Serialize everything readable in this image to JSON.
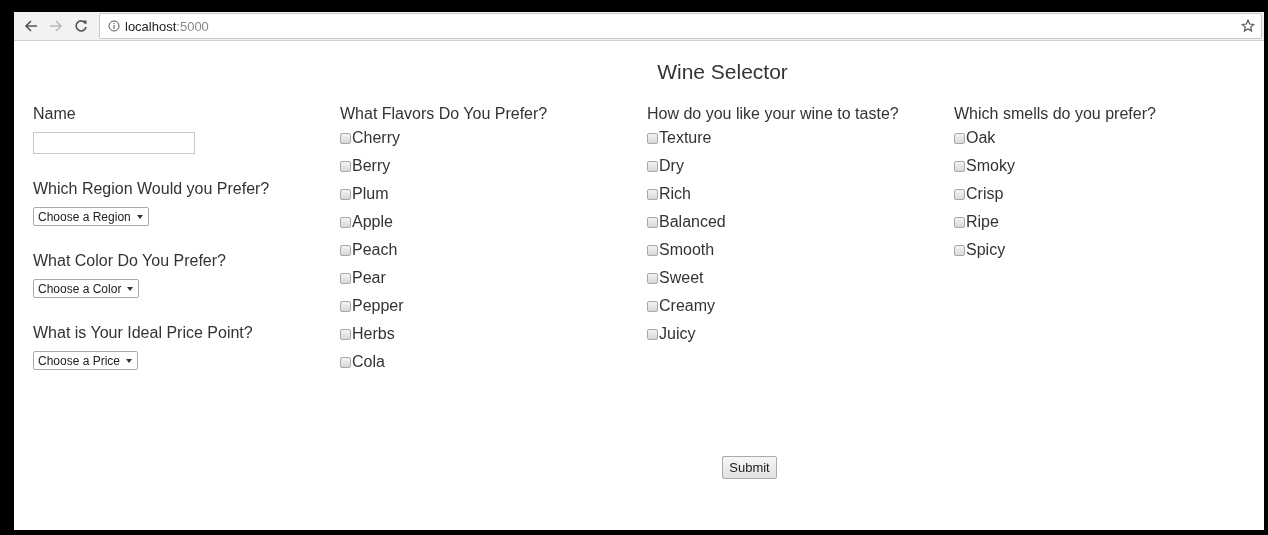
{
  "browser": {
    "host": "localhost",
    "port": ":5000"
  },
  "page": {
    "title": "Wine Selector",
    "columns": [
      {
        "fields": [
          {
            "kind": "text",
            "label": "Name"
          },
          {
            "kind": "select",
            "label": "Which Region Would you Prefer?",
            "value": "Choose a Region"
          },
          {
            "kind": "select",
            "label": "What Color Do You Prefer?",
            "value": "Choose a Color"
          },
          {
            "kind": "select",
            "label": "What is Your Ideal Price Point?",
            "value": "Choose a Price"
          }
        ]
      },
      {
        "fields": [
          {
            "kind": "checkboxes",
            "label": "What Flavors Do You Prefer?",
            "options": [
              {
                "label": "Cherry",
                "checked": false
              },
              {
                "label": "Berry",
                "checked": false
              },
              {
                "label": "Plum",
                "checked": false
              },
              {
                "label": "Apple",
                "checked": false
              },
              {
                "label": "Peach",
                "checked": false
              },
              {
                "label": "Pear",
                "checked": false
              },
              {
                "label": "Pepper",
                "checked": false
              },
              {
                "label": "Herbs",
                "checked": false
              },
              {
                "label": "Cola",
                "checked": false
              }
            ]
          }
        ]
      },
      {
        "fields": [
          {
            "kind": "checkboxes",
            "label": "How do you like your wine to taste?",
            "options": [
              {
                "label": "Texture",
                "checked": false
              },
              {
                "label": "Dry",
                "checked": false
              },
              {
                "label": "Rich",
                "checked": false
              },
              {
                "label": "Balanced",
                "checked": false
              },
              {
                "label": "Smooth",
                "checked": false
              },
              {
                "label": "Sweet",
                "checked": false
              },
              {
                "label": "Creamy",
                "checked": false
              },
              {
                "label": "Juicy",
                "checked": false
              }
            ]
          }
        ]
      },
      {
        "fields": [
          {
            "kind": "checkboxes",
            "label": "Which smells do you prefer?",
            "options": [
              {
                "label": "Oak",
                "checked": false
              },
              {
                "label": "Smoky",
                "checked": false
              },
              {
                "label": "Crisp",
                "checked": false
              },
              {
                "label": "Ripe",
                "checked": false
              },
              {
                "label": "Spicy",
                "checked": false
              }
            ]
          }
        ]
      }
    ],
    "submit": "Submit"
  }
}
